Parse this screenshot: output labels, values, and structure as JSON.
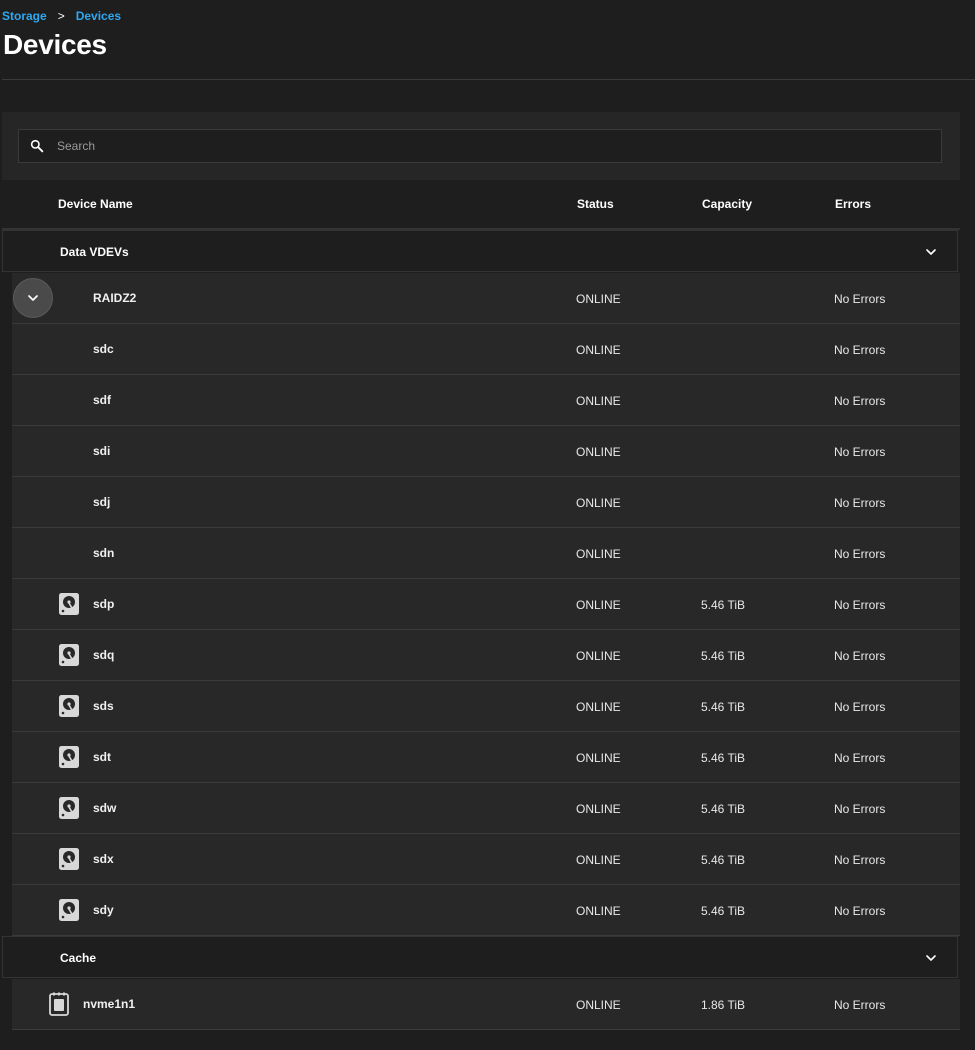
{
  "breadcrumb": {
    "parent": "Storage",
    "separator": ">",
    "current": "Devices"
  },
  "page": {
    "title": "Devices"
  },
  "search": {
    "placeholder": "Search",
    "value": ""
  },
  "columns": {
    "name": "Device Name",
    "status": "Status",
    "capacity": "Capacity",
    "errors": "Errors"
  },
  "groups": {
    "data": {
      "label": "Data VDEVs",
      "vdev": {
        "name": "RAIDZ2",
        "status": "ONLINE",
        "capacity": "",
        "errors": "No Errors"
      },
      "members": [
        {
          "name": "sdc",
          "status": "ONLINE",
          "capacity": "",
          "errors": "No Errors"
        },
        {
          "name": "sdf",
          "status": "ONLINE",
          "capacity": "",
          "errors": "No Errors"
        },
        {
          "name": "sdi",
          "status": "ONLINE",
          "capacity": "",
          "errors": "No Errors"
        },
        {
          "name": "sdj",
          "status": "ONLINE",
          "capacity": "",
          "errors": "No Errors"
        },
        {
          "name": "sdn",
          "status": "ONLINE",
          "capacity": "",
          "errors": "No Errors"
        },
        {
          "name": "sdp",
          "status": "ONLINE",
          "capacity": "5.46 TiB",
          "errors": "No Errors",
          "icon": "hdd-icon"
        },
        {
          "name": "sdq",
          "status": "ONLINE",
          "capacity": "5.46 TiB",
          "errors": "No Errors",
          "icon": "hdd-icon"
        },
        {
          "name": "sds",
          "status": "ONLINE",
          "capacity": "5.46 TiB",
          "errors": "No Errors",
          "icon": "hdd-icon"
        },
        {
          "name": "sdt",
          "status": "ONLINE",
          "capacity": "5.46 TiB",
          "errors": "No Errors",
          "icon": "hdd-icon"
        },
        {
          "name": "sdw",
          "status": "ONLINE",
          "capacity": "5.46 TiB",
          "errors": "No Errors",
          "icon": "hdd-icon"
        },
        {
          "name": "sdx",
          "status": "ONLINE",
          "capacity": "5.46 TiB",
          "errors": "No Errors",
          "icon": "hdd-icon"
        },
        {
          "name": "sdy",
          "status": "ONLINE",
          "capacity": "5.46 TiB",
          "errors": "No Errors",
          "icon": "hdd-icon"
        }
      ]
    },
    "cache": {
      "label": "Cache",
      "devices": [
        {
          "name": "nvme1n1",
          "status": "ONLINE",
          "capacity": "1.86 TiB",
          "errors": "No Errors",
          "icon": "ssd-icon"
        }
      ]
    }
  },
  "colors": {
    "link": "#2ea8f0",
    "background": "#1e1e1e",
    "row": "#282828"
  }
}
